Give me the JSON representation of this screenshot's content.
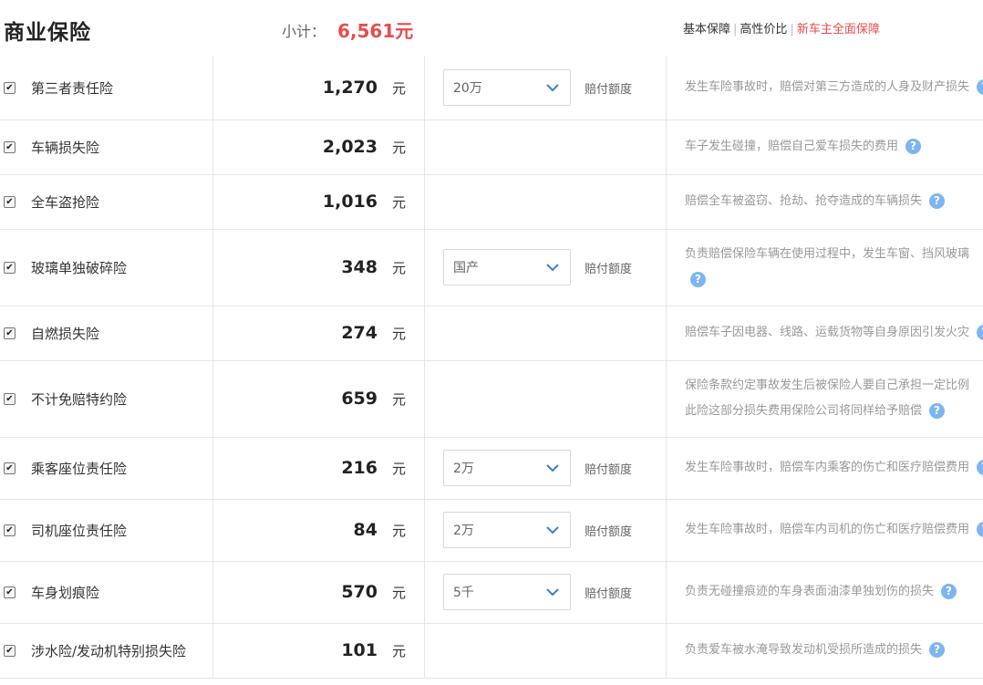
{
  "header": {
    "title": "商业保险",
    "subtotal_label": "小计：",
    "subtotal_value": "6,561元",
    "plans": [
      "基本保障",
      "高性价比",
      "新车主全面保障"
    ]
  },
  "unit": "元",
  "option_label": "赔付额度",
  "rows": [
    {
      "name": "第三者责任险",
      "price": "1,270",
      "option": "20万",
      "desc": [
        "发生车险事故时，赔偿对第三方造成的人身及财产损失"
      ]
    },
    {
      "name": "车辆损失险",
      "price": "2,023",
      "desc": [
        "车子发生碰撞，赔偿自己爱车损失的费用"
      ]
    },
    {
      "name": "全车盗抢险",
      "price": "1,016",
      "desc": [
        "赔偿全车被盗窃、抢劫、抢夺造成的车辆损失"
      ]
    },
    {
      "name": "玻璃单独破碎险",
      "price": "348",
      "option": "国产",
      "desc": [
        "负责赔偿保险车辆在使用过程中，发生车窗、挡风玻璃"
      ]
    },
    {
      "name": "自燃损失险",
      "price": "274",
      "desc": [
        "赔偿车子因电器、线路、运载货物等自身原因引发火灾"
      ]
    },
    {
      "name": "不计免赔特约险",
      "price": "659",
      "desc": [
        "保险条款约定事故发生后被保险人要自己承担一定比例",
        "此险这部分损失费用保险公司将同样给予赔偿"
      ]
    },
    {
      "name": "乘客座位责任险",
      "price": "216",
      "option": "2万",
      "desc": [
        "发生车险事故时，赔偿车内乘客的伤亡和医疗赔偿费用"
      ]
    },
    {
      "name": "司机座位责任险",
      "price": "84",
      "option": "2万",
      "desc": [
        "发生车险事故时，赔偿车内司机的伤亡和医疗赔偿费用"
      ]
    },
    {
      "name": "车身划痕险",
      "price": "570",
      "option": "5千",
      "desc": [
        "负责无碰撞痕迹的车身表面油漆单独划伤的损失"
      ]
    },
    {
      "name": "涉水险/发动机特别损失险",
      "price": "101",
      "desc": [
        "负责爱车被水淹导致发动机受损所造成的损失"
      ]
    }
  ]
}
